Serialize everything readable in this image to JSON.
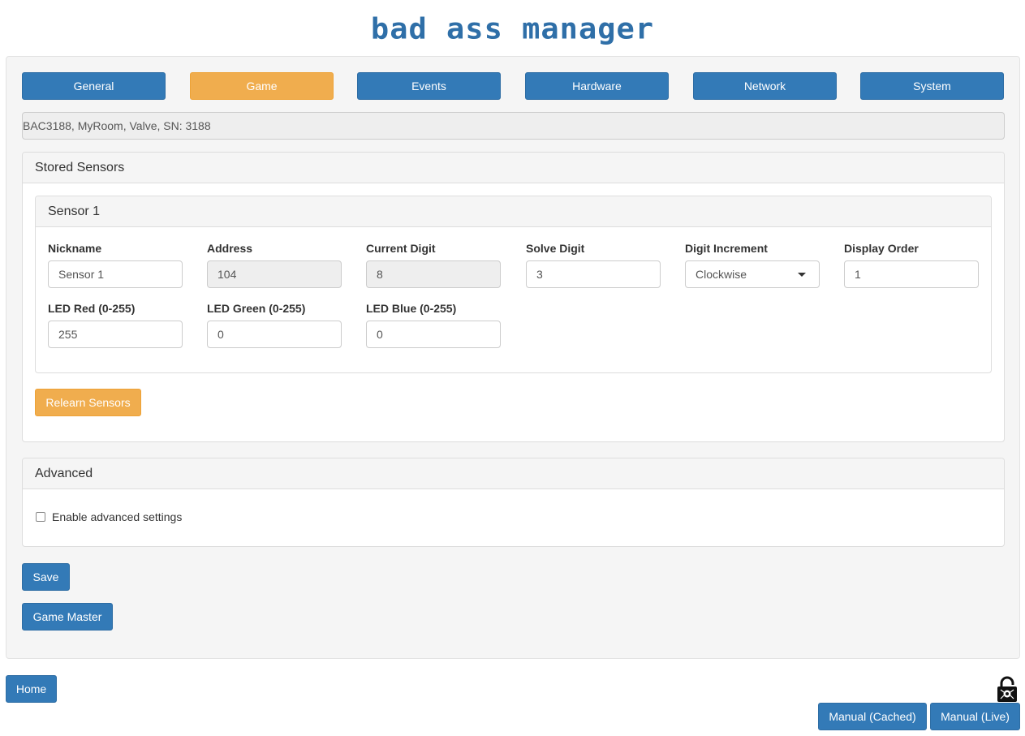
{
  "app": {
    "title": "bad ass manager"
  },
  "tabs": [
    {
      "label": "General",
      "active": false
    },
    {
      "label": "Game",
      "active": true
    },
    {
      "label": "Events",
      "active": false
    },
    {
      "label": "Hardware",
      "active": false
    },
    {
      "label": "Network",
      "active": false
    },
    {
      "label": "System",
      "active": false
    }
  ],
  "device_info": "BAC3188, MyRoom, Valve, SN: 3188",
  "stored_sensors": {
    "heading": "Stored Sensors",
    "sensor": {
      "heading": "Sensor 1",
      "fields": {
        "nickname": {
          "label": "Nickname",
          "value": "Sensor 1"
        },
        "address": {
          "label": "Address",
          "value": "104"
        },
        "current_digit": {
          "label": "Current Digit",
          "value": "8"
        },
        "solve_digit": {
          "label": "Solve Digit",
          "value": "3"
        },
        "digit_increment": {
          "label": "Digit Increment",
          "value": "Clockwise"
        },
        "display_order": {
          "label": "Display Order",
          "value": "1"
        },
        "led_red": {
          "label": "LED Red (0-255)",
          "value": "255"
        },
        "led_green": {
          "label": "LED Green (0-255)",
          "value": "0"
        },
        "led_blue": {
          "label": "LED Blue (0-255)",
          "value": "0"
        }
      }
    },
    "relearn_label": "Relearn Sensors"
  },
  "advanced": {
    "heading": "Advanced",
    "checkbox_label": "Enable advanced settings",
    "checked": false
  },
  "actions": {
    "save_label": "Save",
    "game_master_label": "Game Master",
    "home_label": "Home",
    "manual_cached_label": "Manual (Cached)",
    "manual_live_label": "Manual (Live)"
  },
  "colors": {
    "primary": "#337ab7",
    "warning": "#f0ad4e",
    "title": "#2f6fa8"
  },
  "icons": {
    "lock": "lock-icon",
    "dropdown": "caret-down-icon"
  }
}
